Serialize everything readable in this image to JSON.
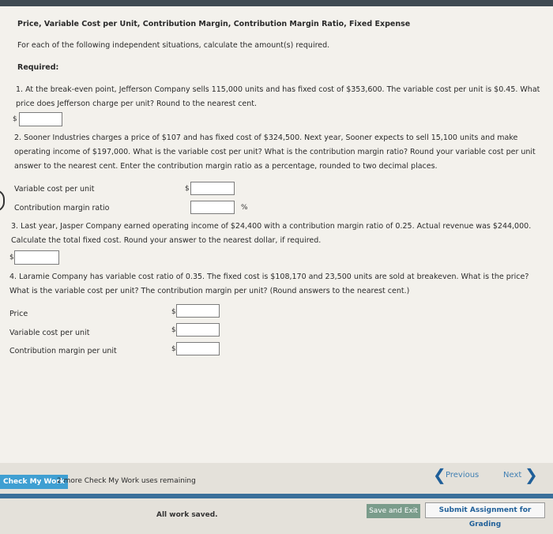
{
  "page": {
    "title": "Price, Variable Cost per Unit, Contribution Margin, Contribution Margin Ratio, Fixed Expense",
    "intro": "For each of the following independent situations, calculate the amount(s) required.",
    "required_label": "Required:"
  },
  "q1": {
    "text": "1. At the break-even point, Jefferson Company sells 115,000 units and has fixed cost of $353,600. The variable cost per unit is $0.45. What price does Jefferson charge per unit? Round to the nearest cent.",
    "currency": "$"
  },
  "q2": {
    "text": "2. Sooner Industries charges a price of $107 and has fixed cost of $324,500. Next year, Sooner expects to sell 15,100 units and make operating income of $197,000. What is the variable cost per unit? What is the contribution margin ratio? Round your variable cost per unit answer to the nearest cent. Enter the contribution margin ratio as a percentage, rounded to two decimal places.",
    "variable_label": "Variable cost per unit",
    "cm_ratio_label": "Contribution margin ratio",
    "currency": "$",
    "percent": "%"
  },
  "q3": {
    "text": "3. Last year, Jasper Company earned operating income of $24,400 with a contribution margin ratio of 0.25. Actual revenue was $244,000. Calculate the total fixed cost. Round your answer to the nearest dollar, if required.",
    "currency": "$"
  },
  "q4": {
    "text": "4. Laramie Company has variable cost ratio of 0.35. The fixed cost is $108,170 and 23,500 units are sold at breakeven. What is the price? What is the variable cost per unit? The contribution margin per unit? (Round answers to the nearest cent.)",
    "price_label": "Price",
    "variable_label": "Variable cost per unit",
    "cm_label": "Contribution margin per unit",
    "currency": "$"
  },
  "footer": {
    "check_label": "Check My Work",
    "remaining": "2 more Check My Work uses remaining",
    "previous": "Previous",
    "next": "Next",
    "saved": "All work saved.",
    "save_exit": "Save and Exit",
    "submit": "Submit Assignment for Grading"
  },
  "colors": {
    "accent": "#3f9fd2",
    "nav": "#1f5f99",
    "bar": "#3a6f9a"
  }
}
